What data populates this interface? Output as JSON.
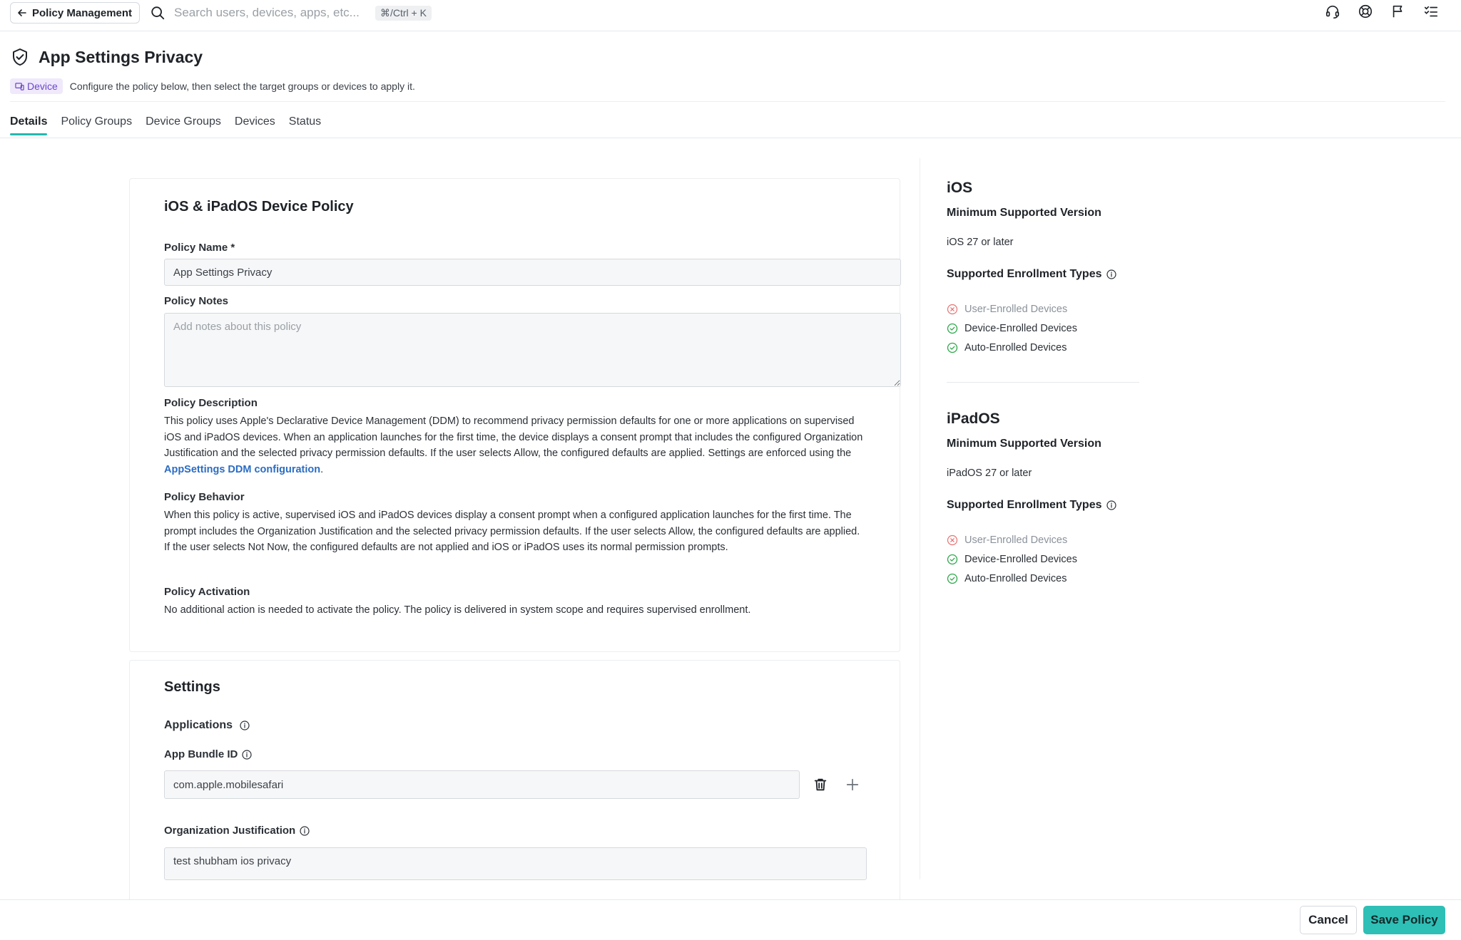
{
  "topbar": {
    "back_label": "Policy Management",
    "search_placeholder": "Search users, devices, apps, etc...",
    "shortcut": "⌘/Ctrl + K",
    "icons": [
      "headset-icon",
      "globe-icon",
      "flag-icon",
      "tasks-icon"
    ]
  },
  "header": {
    "title": "App Settings Privacy",
    "badge": "Device",
    "subtitle": "Configure the policy below, then select the target groups or devices to apply it."
  },
  "tabs": [
    {
      "label": "Details",
      "active": true
    },
    {
      "label": "Policy Groups",
      "active": false
    },
    {
      "label": "Device Groups",
      "active": false
    },
    {
      "label": "Devices",
      "active": false
    },
    {
      "label": "Status",
      "active": false
    }
  ],
  "policy_card": {
    "title": "iOS & iPadOS Device Policy",
    "name_label": "Policy Name *",
    "name_value": "App Settings Privacy",
    "notes_label": "Policy Notes",
    "notes_placeholder": "Add notes about this policy",
    "description_label": "Policy Description",
    "description_text": "This policy uses Apple's Declarative Device Management (DDM) to recommend privacy permission defaults for one or more applications on supervised iOS and iPadOS devices. When an application launches for the first time, the device displays a consent prompt that includes the configured Organization Justification and the selected privacy permission defaults. If the user selects Allow, the configured defaults are applied. Settings are enforced using the ",
    "description_link": "AppSettings DDM configuration",
    "description_end": ".",
    "behavior_label": "Policy Behavior",
    "behavior_text": "When this policy is active, supervised iOS and iPadOS devices display a consent prompt when a configured application launches for the first time. The prompt includes the Organization Justification and the selected privacy permission defaults. If the user selects Allow, the configured defaults are applied. If the user selects Not Now, the configured defaults are not applied and iOS or iPadOS uses its normal permission prompts.",
    "activation_label": "Policy Activation",
    "activation_text": "No additional action is needed to activate the policy. The policy is delivered in system scope and requires supervised enrollment."
  },
  "settings_card": {
    "title": "Settings",
    "applications_label": "Applications",
    "bundle_label": "App Bundle ID",
    "bundle_value": "com.apple.mobilesafari",
    "justification_label": "Organization Justification",
    "justification_value": "test shubham ios privacy"
  },
  "platforms": [
    {
      "title": "iOS",
      "min_version_label": "Minimum Supported Version",
      "min_version": "iOS 27 or later",
      "enrollment_label": "Supported Enrollment Types",
      "enrollment": [
        {
          "label": "User-Enrolled Devices",
          "supported": false
        },
        {
          "label": "Device-Enrolled Devices",
          "supported": true
        },
        {
          "label": "Auto-Enrolled Devices",
          "supported": true
        }
      ]
    },
    {
      "title": "iPadOS",
      "min_version_label": "Minimum Supported Version",
      "min_version": "iPadOS 27 or later",
      "enrollment_label": "Supported Enrollment Types",
      "enrollment": [
        {
          "label": "User-Enrolled Devices",
          "supported": false
        },
        {
          "label": "Device-Enrolled Devices",
          "supported": true
        },
        {
          "label": "Auto-Enrolled Devices",
          "supported": true
        }
      ]
    }
  ],
  "footer": {
    "cancel_label": "Cancel",
    "save_label": "Save Policy"
  },
  "colors": {
    "accent": "#2ebfb6",
    "link": "#2b6cc4",
    "badge_bg": "#efe9fb",
    "badge_text": "#6b47c9",
    "check": "#2ea84a",
    "cross": "#e57373"
  }
}
